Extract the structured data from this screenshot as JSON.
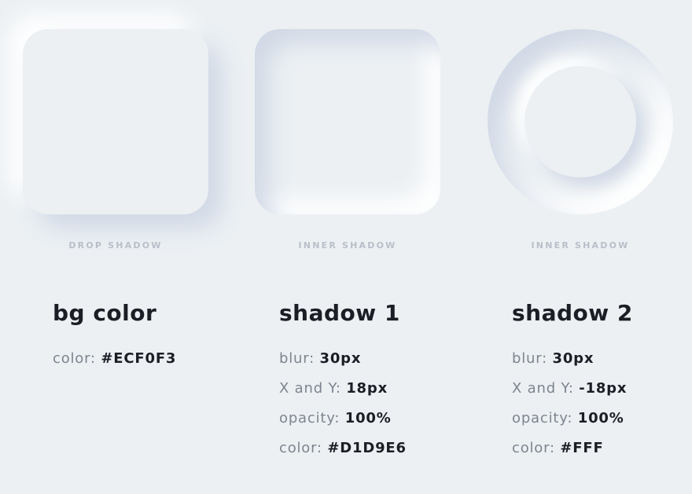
{
  "panels": [
    {
      "caption": "DROP SHADOW"
    },
    {
      "caption": "INNER SHADOW"
    },
    {
      "caption": "INNER SHADOW"
    }
  ],
  "columns": [
    {
      "title": "bg color",
      "rows": [
        {
          "label": "color: ",
          "value": "#ECF0F3"
        }
      ]
    },
    {
      "title": "shadow 1",
      "rows": [
        {
          "label": "blur: ",
          "value": "30px"
        },
        {
          "label": "X and Y: ",
          "value": "18px"
        },
        {
          "label": "opacity: ",
          "value": "100%"
        },
        {
          "label": "color: ",
          "value": "#D1D9E6"
        }
      ]
    },
    {
      "title": "shadow 2",
      "rows": [
        {
          "label": "blur: ",
          "value": "30px"
        },
        {
          "label": "X and Y: ",
          "value": "-18px"
        },
        {
          "label": "opacity: ",
          "value": "100%"
        },
        {
          "label": "color: ",
          "value": "#FFF"
        }
      ]
    }
  ],
  "colors": {
    "background": "#ECF0F3",
    "shadow_dark": "#D1D9E6",
    "shadow_light": "#FFFFFF"
  }
}
